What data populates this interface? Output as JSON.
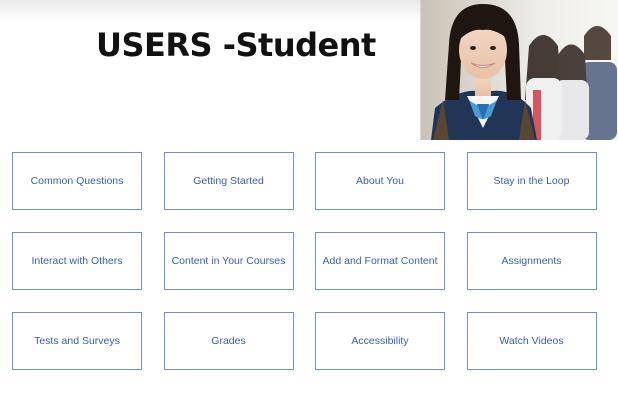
{
  "page": {
    "title": "USERS -Student"
  },
  "hero_image": {
    "alt": "Smiling students in school uniforms"
  },
  "tiles": [
    {
      "label": "Common Questions"
    },
    {
      "label": "Getting Started"
    },
    {
      "label": "About You"
    },
    {
      "label": "Stay in the Loop"
    },
    {
      "label": "Interact with Others"
    },
    {
      "label": "Content in Your Courses"
    },
    {
      "label": "Add and Format Content"
    },
    {
      "label": "Assignments"
    },
    {
      "label": "Tests and Surveys"
    },
    {
      "label": "Grades"
    },
    {
      "label": "Accessibility"
    },
    {
      "label": "Watch Videos"
    }
  ],
  "colors": {
    "tile_border": "#6f8fd6",
    "tile_text": "#3a5db3",
    "title_text": "#111111"
  }
}
